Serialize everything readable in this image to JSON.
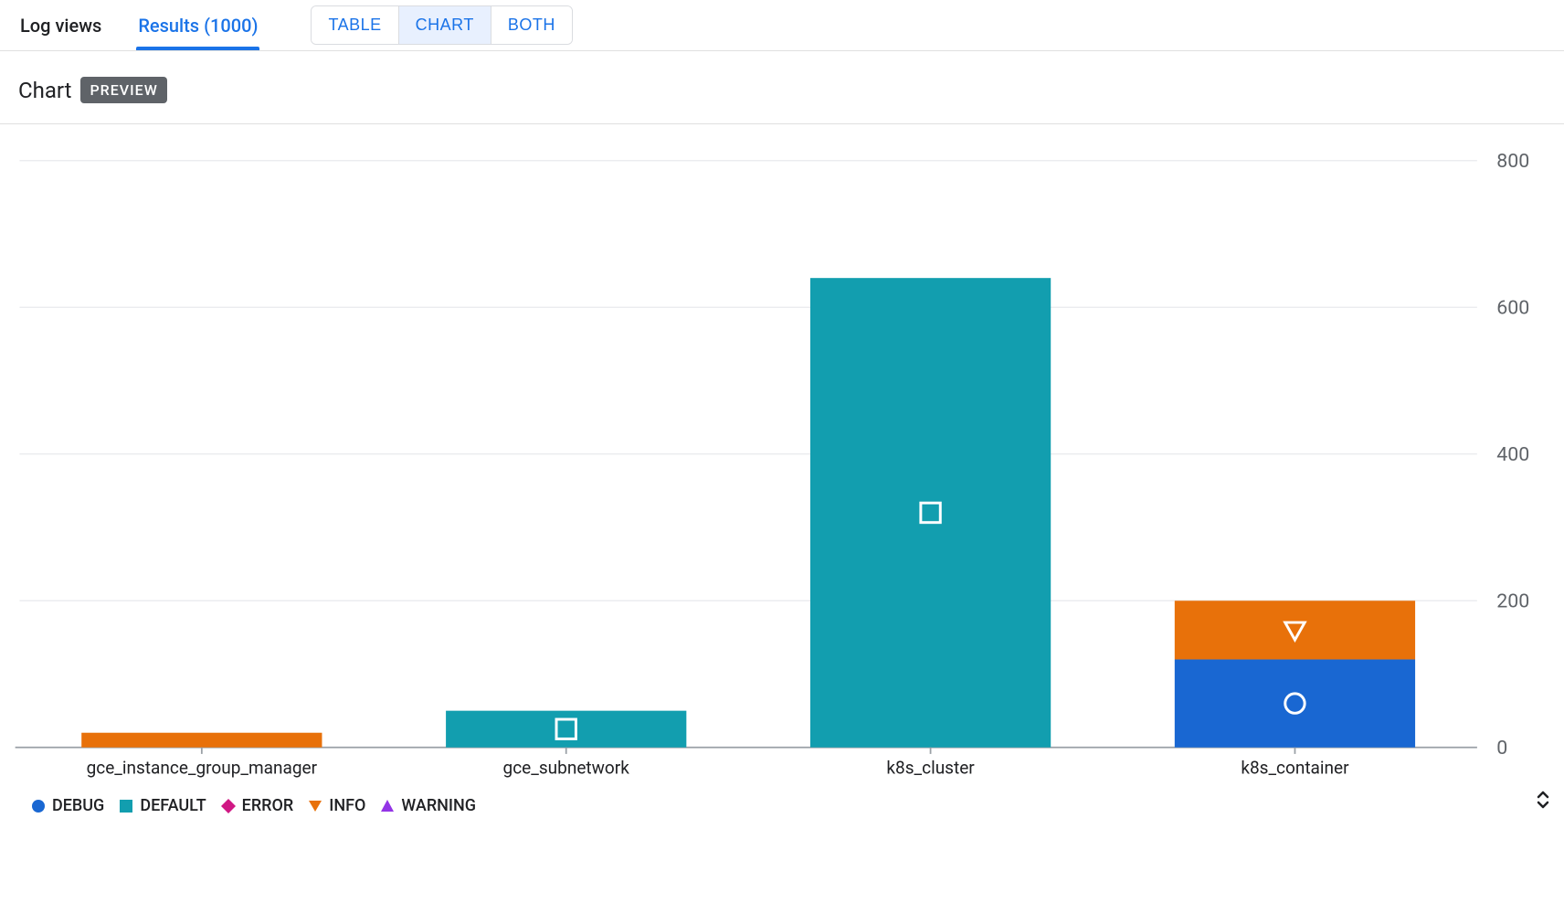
{
  "tabs": {
    "log_views": "Log views",
    "results": "Results (1000)"
  },
  "view_toggle": {
    "table": "TABLE",
    "chart": "CHART",
    "both": "BOTH"
  },
  "section": {
    "title": "Chart",
    "badge": "PREVIEW"
  },
  "legend": {
    "debug": "DEBUG",
    "default": "DEFAULT",
    "error": "ERROR",
    "info": "INFO",
    "warning": "WARNING"
  },
  "colors": {
    "debug": "#1967d2",
    "default": "#129eaf",
    "error": "#d01884",
    "info": "#e8710a",
    "warning": "#9334e6"
  },
  "chart_data": {
    "type": "bar",
    "stacked": true,
    "categories": [
      "gce_instance_group_manager",
      "gce_subnetwork",
      "k8s_cluster",
      "k8s_container"
    ],
    "series": [
      {
        "name": "DEBUG",
        "values": [
          0,
          0,
          0,
          120
        ]
      },
      {
        "name": "DEFAULT",
        "values": [
          0,
          50,
          640,
          0
        ]
      },
      {
        "name": "ERROR",
        "values": [
          0,
          0,
          0,
          0
        ]
      },
      {
        "name": "INFO",
        "values": [
          20,
          0,
          0,
          80
        ]
      },
      {
        "name": "WARNING",
        "values": [
          0,
          0,
          0,
          0
        ]
      }
    ],
    "ylim": [
      0,
      800
    ],
    "y_ticks": [
      0,
      200,
      400,
      600,
      800
    ],
    "title": "",
    "xlabel": "",
    "ylabel": ""
  }
}
